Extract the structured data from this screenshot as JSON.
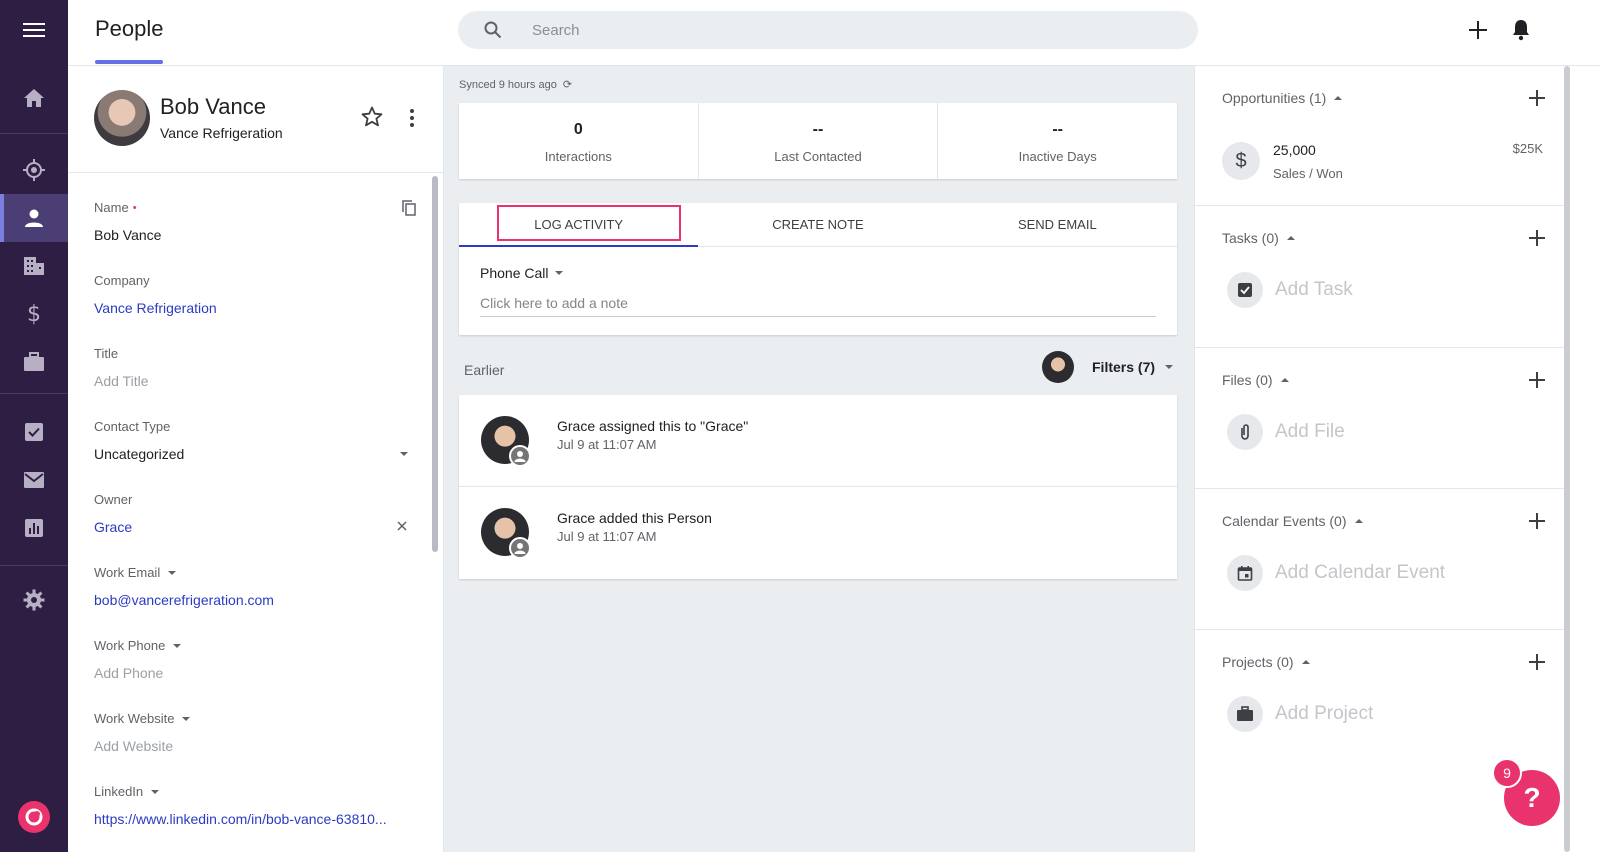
{
  "header": {
    "title": "People",
    "search_placeholder": "Search"
  },
  "nav": {
    "items": [
      {
        "icon": "home-icon"
      },
      {
        "icon": "leads-icon"
      },
      {
        "icon": "people-icon"
      },
      {
        "icon": "companies-icon"
      },
      {
        "icon": "opportunities-icon"
      },
      {
        "icon": "projects-icon"
      },
      {
        "icon": "tasks-icon"
      },
      {
        "icon": "email-icon"
      },
      {
        "icon": "reports-icon"
      },
      {
        "icon": "settings-icon"
      }
    ]
  },
  "profile": {
    "name": "Bob Vance",
    "company": "Vance Refrigeration"
  },
  "fields": {
    "name_label": "Name",
    "name_value": "Bob Vance",
    "company_label": "Company",
    "company_value": "Vance Refrigeration",
    "title_label": "Title",
    "title_value": "Add Title",
    "contact_type_label": "Contact Type",
    "contact_type_value": "Uncategorized",
    "owner_label": "Owner",
    "owner_value": "Grace",
    "work_email_label": "Work Email",
    "work_email_value": "bob@vancerefrigeration.com",
    "work_phone_label": "Work Phone",
    "work_phone_value": "Add Phone",
    "work_website_label": "Work Website",
    "work_website_value": "Add Website",
    "linkedin_label": "LinkedIn",
    "linkedin_value": "https://www.linkedin.com/in/bob-vance-63810..."
  },
  "synced": "Synced 9 hours ago",
  "stats": [
    {
      "value": "0",
      "label": "Interactions"
    },
    {
      "value": "--",
      "label": "Last Contacted"
    },
    {
      "value": "--",
      "label": "Inactive Days"
    }
  ],
  "composer": {
    "tabs": [
      "LOG ACTIVITY",
      "CREATE NOTE",
      "SEND EMAIL"
    ],
    "activity_type": "Phone Call",
    "note_placeholder": "Click here to add a note"
  },
  "feed": {
    "earlier_label": "Earlier",
    "filters_label": "Filters (7)",
    "items": [
      {
        "text": "Grace assigned this to \"Grace\"",
        "time": "Jul 9 at 11:07 AM"
      },
      {
        "text": "Grace added this Person",
        "time": "Jul 9 at 11:07 AM"
      }
    ]
  },
  "related": {
    "opportunities_title": "Opportunities (1)",
    "opportunity_name": "25,000",
    "opportunity_stage": "Sales / Won",
    "opportunity_amount": "$25K",
    "tasks_title": "Tasks (0)",
    "tasks_add": "Add Task",
    "files_title": "Files (0)",
    "files_add": "Add File",
    "calendar_title": "Calendar Events (0)",
    "calendar_add": "Add Calendar Event",
    "projects_title": "Projects (0)",
    "projects_add": "Add Project"
  },
  "help": {
    "badge_count": "9",
    "label": "?"
  },
  "colors": {
    "nav_bg": "#2f1e44",
    "accent": "#6770e0",
    "link": "#2b3bc4",
    "brand_pink": "#e8336c"
  }
}
